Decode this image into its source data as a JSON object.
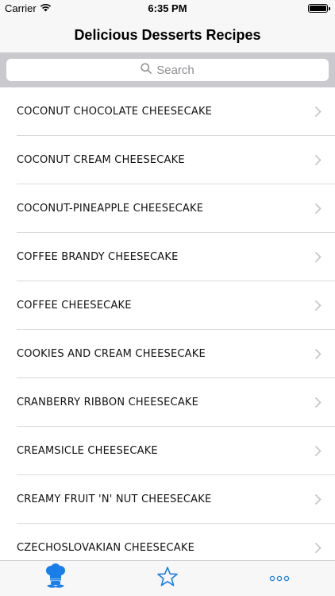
{
  "status_bar": {
    "carrier": "Carrier",
    "time": "6:35 PM"
  },
  "nav": {
    "title": "Delicious Desserts Recipes"
  },
  "search": {
    "placeholder": "Search"
  },
  "recipes": [
    "COCONUT CHOCOLATE CHEESECAKE",
    "COCONUT CREAM CHEESECAKE",
    "COCONUT-PINEAPPLE CHEESECAKE",
    "COFFEE BRANDY CHEESECAKE",
    "COFFEE CHEESECAKE",
    "COOKIES AND CREAM CHEESECAKE",
    "CRANBERRY RIBBON CHEESECAKE",
    "CREAMSICLE CHEESECAKE",
    "CREAMY FRUIT 'N' NUT CHEESECAKE",
    "CZECHOSLOVAKIAN CHEESECAKE"
  ],
  "tabs": [
    {
      "icon": "chef-icon",
      "active": true
    },
    {
      "icon": "star-icon",
      "active": false
    },
    {
      "icon": "more-icon",
      "active": false
    }
  ],
  "colors": {
    "accent": "#1a7ee8",
    "separator": "#d9d9dc",
    "chevron": "#c7c7cc",
    "search_bar_bg": "#c9c9ce"
  }
}
